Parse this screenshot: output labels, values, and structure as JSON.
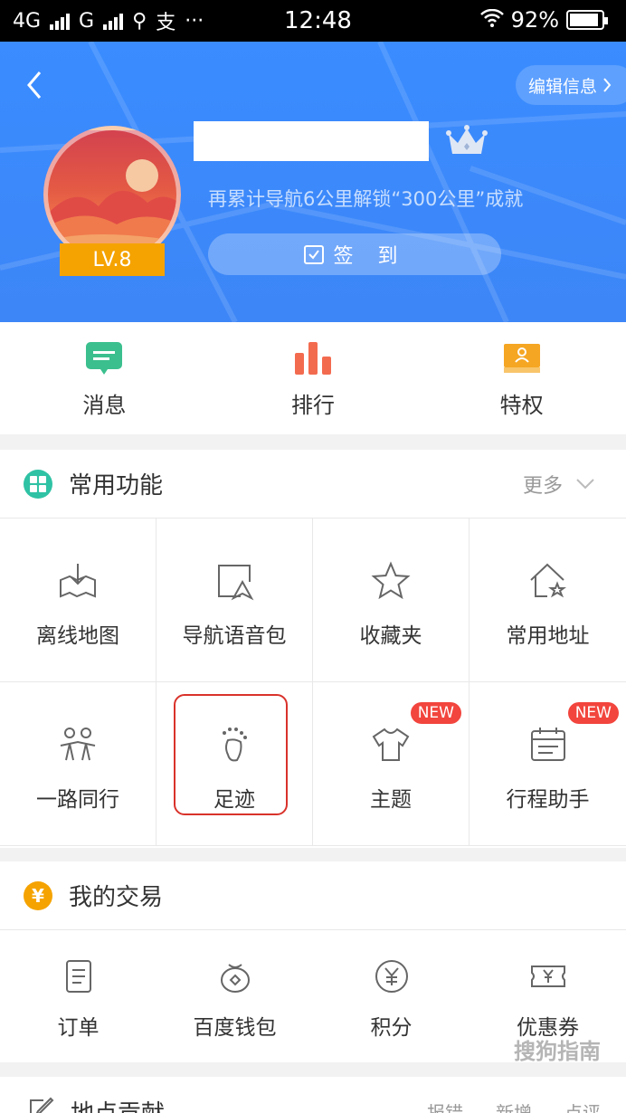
{
  "status_bar": {
    "network1": "4G",
    "network2": "G",
    "alipay_glyph": "支",
    "dots": "···",
    "time": "12:48",
    "battery": "92%",
    "battery_level": 0.92
  },
  "header": {
    "edit_label": "编辑信息",
    "level": "LV.8",
    "hint": "再累计导航6公里解锁“300公里”成就",
    "signin_label": "签 到"
  },
  "quick_actions": [
    {
      "label": "消息",
      "icon": "message-icon",
      "color": "#3bbf8e"
    },
    {
      "label": "排行",
      "icon": "ranking-icon",
      "color": "#f36b4f"
    },
    {
      "label": "特权",
      "icon": "privilege-icon",
      "color": "#f5a623"
    }
  ],
  "common": {
    "title": "常用功能",
    "more": "更多",
    "items": [
      {
        "label": "离线地图",
        "icon": "offline-map-icon"
      },
      {
        "label": "导航语音包",
        "icon": "voice-pack-icon"
      },
      {
        "label": "收藏夹",
        "icon": "favorites-star-icon"
      },
      {
        "label": "常用地址",
        "icon": "common-address-icon"
      },
      {
        "label": "一路同行",
        "icon": "companions-icon"
      },
      {
        "label": "足迹",
        "icon": "footprint-icon"
      },
      {
        "label": "主题",
        "icon": "theme-shirt-icon",
        "badge": "NEW"
      },
      {
        "label": "行程助手",
        "icon": "trip-calendar-icon",
        "badge": "NEW"
      }
    ]
  },
  "trade": {
    "title": "我的交易",
    "items": [
      {
        "label": "订单",
        "icon": "order-icon"
      },
      {
        "label": "百度钱包",
        "icon": "wallet-icon"
      },
      {
        "label": "积分",
        "icon": "points-icon"
      },
      {
        "label": "优惠券",
        "icon": "coupon-icon"
      }
    ]
  },
  "contrib": {
    "title": "地点贡献",
    "links": [
      "报错",
      "新增",
      "点评"
    ]
  },
  "watermark": "搜狗指南"
}
